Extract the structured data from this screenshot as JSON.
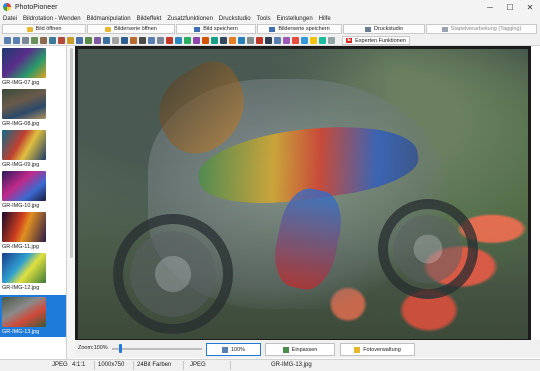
{
  "window": {
    "title": "PhotoPioneer",
    "controls": {
      "minimize": "─",
      "maximize": "☐",
      "close": "✕"
    }
  },
  "menu": [
    "Datei",
    "Bildrotation - Wenden",
    "Bildmanipulation",
    "Bildeffekt",
    "Zusatzfunktionen",
    "Druckstudio",
    "Tools",
    "Einstellungen",
    "Hilfe"
  ],
  "buttons": {
    "open_image": "Bild öffnen",
    "open_series": "Bilderserie öffnen",
    "save_image": "Bild speichern",
    "save_series": "Bilderserie speichern",
    "print_studio": "Druckstudio",
    "batch_processing": "Stapelverarbeitung (Tagging)",
    "expert_functions": "Experten Funktionen",
    "expert_icon_letter": "E"
  },
  "thumbnails": [
    {
      "label": "GR-IMG-07.jpg",
      "selected": false
    },
    {
      "label": "GR-IMG-08.jpg",
      "selected": false
    },
    {
      "label": "GR-IMG-09.jpg",
      "selected": false
    },
    {
      "label": "GR-IMG-10.jpg",
      "selected": false
    },
    {
      "label": "GR-IMG-11.jpg",
      "selected": false
    },
    {
      "label": "GR-IMG-12.jpg",
      "selected": false
    },
    {
      "label": "GR-IMG-13.jpg",
      "selected": true
    }
  ],
  "zoom": {
    "label": "Zoom:100%",
    "level_fraction": 0.08,
    "btn_100": "100%",
    "btn_fit": "Einpassen",
    "btn_manage": "Fotoverwaltung"
  },
  "status": {
    "format": "JPEG",
    "ratio": "4:1:1",
    "dimensions": "1000x750",
    "colors": "24Bit Farben",
    "type": "JPEG",
    "filename": "GR-IMG-13.jpg"
  },
  "colors": {
    "accent": "#1e7bd9",
    "folder": "#e8b730",
    "expert": "#d62d20"
  }
}
